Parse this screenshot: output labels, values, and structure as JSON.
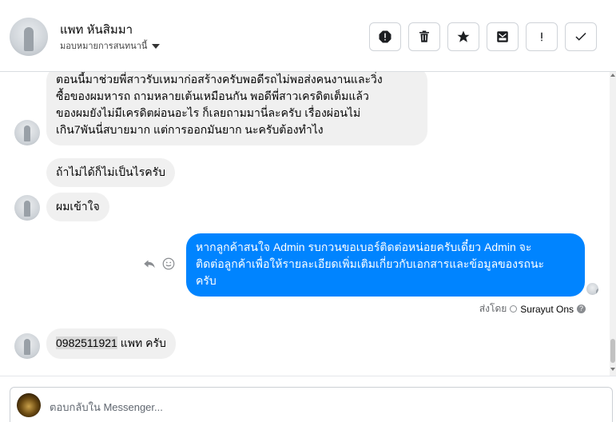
{
  "header": {
    "contact_name": "แพท หันสิมมา",
    "assign_label": "มอบหมายการสนทนานี้",
    "actions": [
      {
        "name": "report-spam-icon"
      },
      {
        "name": "trash-icon"
      },
      {
        "name": "star-icon"
      },
      {
        "name": "move-to-inbox-icon"
      },
      {
        "name": "mark-follow-up-icon"
      },
      {
        "name": "mark-done-icon"
      }
    ]
  },
  "messages": [
    {
      "from": "contact",
      "lines": [
        "ตอนนี้มาช่วยพี่สาวรับเหมาก่อสร้างครับพอดีรถไม่พอส่งคนงานและวิ่ง",
        "ซื้อของผมหารถ ถามหลายเต้นเหมือนกัน พอดีพี่สาวเครดิตเต็มแล้ว",
        "ของผมยังไม่มีเครดิตผ่อนอะไร ก็เลยถามมานี่ละครับ เรื่องผ่อนไม่",
        "เกิน7พันนี่สบายมาก แต่การออกมันยาก นะครับต้องทำไง"
      ]
    },
    {
      "from": "contact",
      "text": "ถ้าไม่ได้ก็ไม่เป็นไรครับ"
    },
    {
      "from": "contact",
      "text": "ผมเข้าใจ"
    },
    {
      "from": "page",
      "lines": [
        "หากลูกค้าสนใจ Admin รบกวนขอเบอร์ติดต่อหน่อยครับเดี๋ยว Admin จะ",
        "ติดต่อลูกค้าเพื่อให้รายละเอียดเพิ่มเติมเกี่ยวกับเอกสารและข้อมูลของรถนะ",
        "ครับ"
      ]
    },
    {
      "from": "contact",
      "phone": "0982511921",
      "rest": " แพท ครับ"
    }
  ],
  "sent_by": {
    "prefix": "ส่งโดย",
    "name": "Surayut Ons",
    "help": "?"
  },
  "composer": {
    "placeholder": "ตอบกลับใน Messenger..."
  },
  "colors": {
    "outgoing_bubble": "#0084ff",
    "incoming_bubble": "#f0f0f0"
  }
}
